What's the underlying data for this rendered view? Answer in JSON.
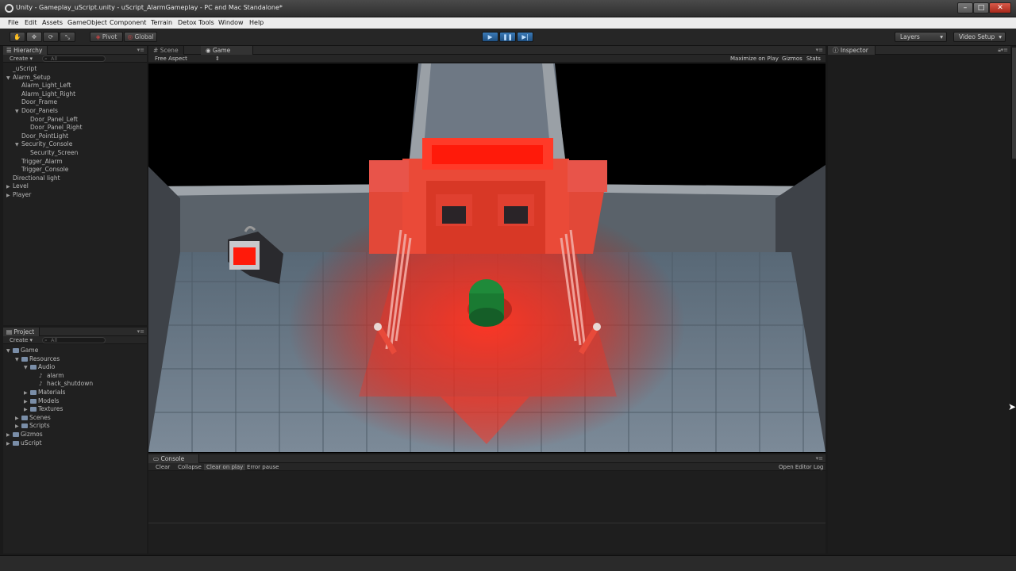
{
  "window": {
    "title": "Unity - Gameplay_uScript.unity - uScript_AlarmGameplay - PC and Mac Standalone*",
    "minimize": "–",
    "maximize": "□",
    "close": "✕"
  },
  "menu": [
    "File",
    "Edit",
    "Assets",
    "GameObject",
    "Component",
    "Terrain",
    "Detox Tools",
    "Window",
    "Help"
  ],
  "toolbar": {
    "pivot": "Pivot",
    "global": "Global",
    "play_icon": "▶",
    "pause_icon": "❚❚",
    "step_icon": "▶|",
    "layers": "Layers",
    "layout": "Video Setup"
  },
  "hierarchy": {
    "tab": "Hierarchy",
    "create": "Create ▾",
    "search_placeholder": "All",
    "items": [
      {
        "label": "_uScript",
        "depth": 0,
        "expanded": null
      },
      {
        "label": "Alarm_Setup",
        "depth": 0,
        "expanded": true
      },
      {
        "label": "Alarm_Light_Left",
        "depth": 1,
        "expanded": null
      },
      {
        "label": "Alarm_Light_Right",
        "depth": 1,
        "expanded": null
      },
      {
        "label": "Door_Frame",
        "depth": 1,
        "expanded": null
      },
      {
        "label": "Door_Panels",
        "depth": 1,
        "expanded": true
      },
      {
        "label": "Door_Panel_Left",
        "depth": 2,
        "expanded": null
      },
      {
        "label": "Door_Panel_Right",
        "depth": 2,
        "expanded": null
      },
      {
        "label": "Door_PointLight",
        "depth": 1,
        "expanded": null
      },
      {
        "label": "Security_Console",
        "depth": 1,
        "expanded": true
      },
      {
        "label": "Security_Screen",
        "depth": 2,
        "expanded": null
      },
      {
        "label": "Trigger_Alarm",
        "depth": 1,
        "expanded": null
      },
      {
        "label": "Trigger_Console",
        "depth": 1,
        "expanded": null
      },
      {
        "label": "Directional light",
        "depth": 0,
        "expanded": null
      },
      {
        "label": "Level",
        "depth": 0,
        "expanded": false
      },
      {
        "label": "Player",
        "depth": 0,
        "expanded": false
      }
    ]
  },
  "project": {
    "tab": "Project",
    "create": "Create ▾",
    "search_placeholder": "All",
    "items": [
      {
        "label": "Game",
        "depth": 0,
        "kind": "folder",
        "expanded": true
      },
      {
        "label": "Resources",
        "depth": 1,
        "kind": "folder",
        "expanded": true
      },
      {
        "label": "Audio",
        "depth": 2,
        "kind": "folder",
        "expanded": true
      },
      {
        "label": "alarm",
        "depth": 3,
        "kind": "audio",
        "expanded": null
      },
      {
        "label": "hack_shutdown",
        "depth": 3,
        "kind": "audio",
        "expanded": null
      },
      {
        "label": "Materials",
        "depth": 2,
        "kind": "folder",
        "expanded": false
      },
      {
        "label": "Models",
        "depth": 2,
        "kind": "folder",
        "expanded": false
      },
      {
        "label": "Textures",
        "depth": 2,
        "kind": "folder",
        "expanded": false
      },
      {
        "label": "Scenes",
        "depth": 1,
        "kind": "folder",
        "expanded": false
      },
      {
        "label": "Scripts",
        "depth": 1,
        "kind": "folder",
        "expanded": false
      },
      {
        "label": "Gizmos",
        "depth": 0,
        "kind": "folder",
        "expanded": false
      },
      {
        "label": "uScript",
        "depth": 0,
        "kind": "folder",
        "expanded": false
      }
    ]
  },
  "scene_panel": {
    "tab_scene": "Scene",
    "tab_game": "Game",
    "aspect": "Free Aspect",
    "maximize_on_play": "Maximize on Play",
    "gizmos": "Gizmos",
    "stats": "Stats"
  },
  "inspector": {
    "tab": "Inspector"
  },
  "console": {
    "tab": "Console",
    "clear": "Clear",
    "collapse": "Collapse",
    "clear_on_play": "Clear on play",
    "error_pause": "Error pause",
    "open_editor_log": "Open Editor Log"
  },
  "colors": {
    "alarm_red": "#ff2a1a",
    "player_green": "#1f8a3a",
    "play_blue": "#3a7ab8"
  }
}
